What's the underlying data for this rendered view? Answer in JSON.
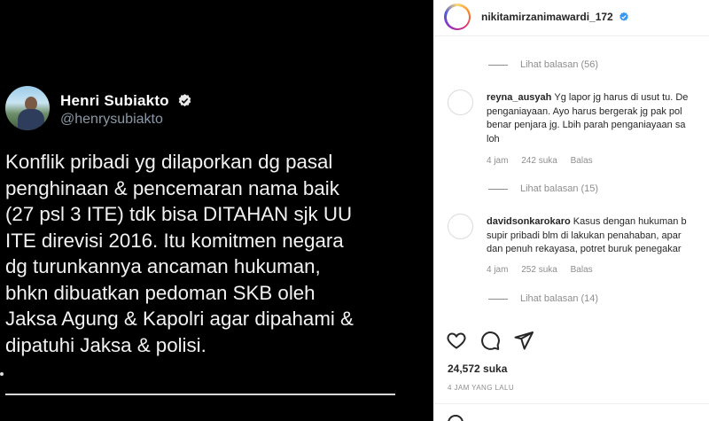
{
  "tweet": {
    "author_name": "Henri Subiakto",
    "author_handle": "@henrysubiakto",
    "lines": [
      "Konflik pribadi yg dilaporkan dg pasal",
      "penghinaan & pencemaran nama baik",
      "(27 psl 3 ITE) tdk bisa DITAHAN sjk UU",
      "ITE direvisi 2016. Itu komitmen negara",
      "dg turunkannya ancaman hukuman,",
      "bhkn dibuatkan pedoman SKB oleh",
      "Jaksa Agung & Kapolri agar dipahami &",
      "dipatuhi Jaksa & polisi."
    ]
  },
  "ig": {
    "username": "nikitamirzanimawardi_172",
    "view_replies": [
      "Lihat balasan (56)",
      "Lihat balasan (15)",
      "Lihat balasan (14)"
    ],
    "comments": [
      {
        "user": "reyna_ausyah",
        "lines": [
          "Yg lapor jg harus di usut tu. De",
          "penganiayaan. Ayo harus bergerak jg pak pol",
          "benar penjara jg. Lbih parah penganiayaan sa",
          "loh"
        ],
        "time": "4 jam",
        "likes": "242 suka",
        "reply": "Balas"
      },
      {
        "user": "davidsonkarokaro",
        "lines": [
          "Kasus dengan hukuman b",
          "supir pribadi blm di lakukan penahaban, apar",
          "dan penuh rekayasa, potret buruk penegakar"
        ],
        "time": "4 jam",
        "likes": "252 suka",
        "reply": "Balas"
      }
    ],
    "likes_count": "24,572 suka",
    "time_ago": "4 JAM YANG LALU",
    "icons": [
      "heart-icon",
      "comment-icon",
      "share-icon"
    ]
  }
}
